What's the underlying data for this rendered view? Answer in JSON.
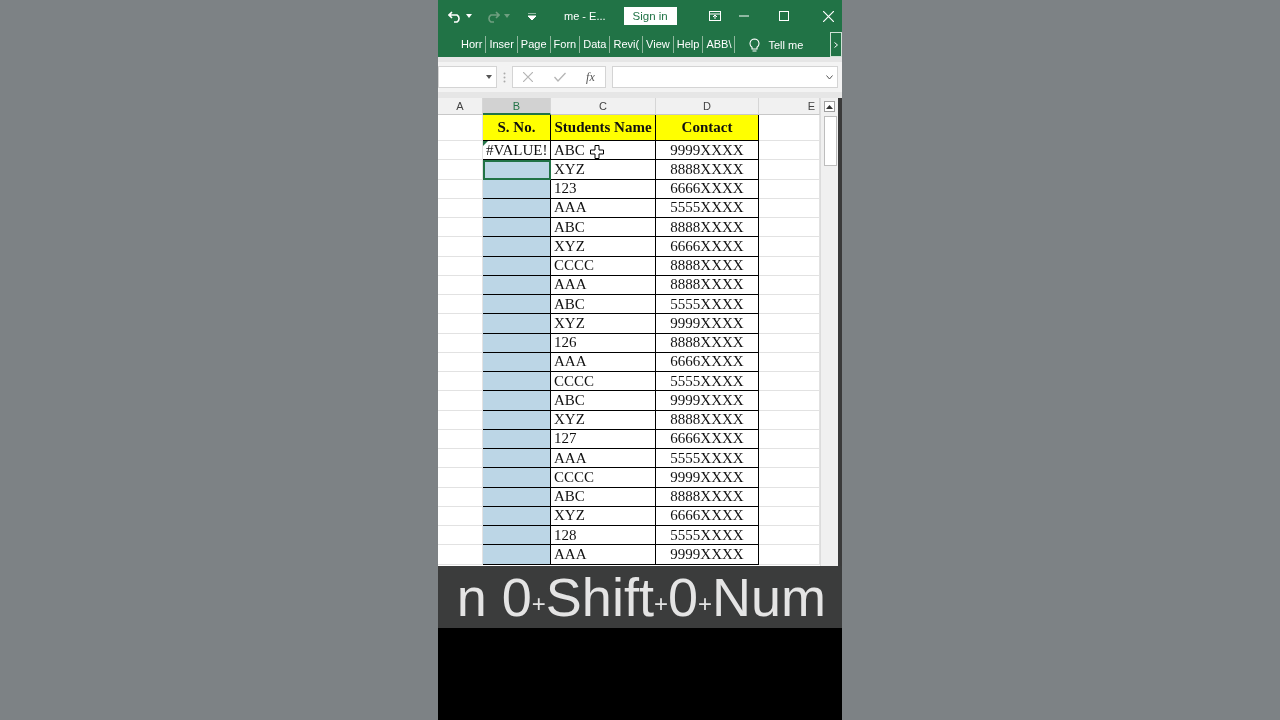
{
  "title_bar": {
    "file_name": "me  -  E...",
    "sign_in": "Sign in",
    "redo_disabled": true
  },
  "ribbon_tabs": [
    {
      "label": "Horr"
    },
    {
      "label": "Inser"
    },
    {
      "label": "Page"
    },
    {
      "label": "Forn"
    },
    {
      "label": "Data"
    },
    {
      "label": "Revi("
    },
    {
      "label": "View"
    },
    {
      "label": "Help"
    },
    {
      "label": "ABB\\"
    }
  ],
  "tell_me": "Tell me",
  "formula_bar": {
    "fx": "fx"
  },
  "columns": [
    {
      "label": "A",
      "selected": false
    },
    {
      "label": "B",
      "selected": true
    },
    {
      "label": "C",
      "selected": false
    },
    {
      "label": "D",
      "selected": false
    },
    {
      "label": "E",
      "selected": false
    }
  ],
  "header_row": [
    "S. No.",
    "Students Name",
    "Contact"
  ],
  "rows": [
    {
      "sno": "#VALUE!",
      "name": "ABC",
      "contact": "9999XXXX",
      "selected": false,
      "active": false,
      "error_flag": true
    },
    {
      "name": "XYZ",
      "contact": "8888XXXX",
      "selected": true,
      "active": true
    },
    {
      "name": "123",
      "contact": "6666XXXX",
      "selected": true,
      "active": false
    },
    {
      "name": "AAA",
      "contact": "5555XXXX",
      "selected": true,
      "active": false
    },
    {
      "name": "ABC",
      "contact": "8888XXXX",
      "selected": true,
      "active": false
    },
    {
      "name": "XYZ",
      "contact": "6666XXXX",
      "selected": true,
      "active": false
    },
    {
      "name": "CCCC",
      "contact": "8888XXXX",
      "selected": true,
      "active": false
    },
    {
      "name": "AAA",
      "contact": "8888XXXX",
      "selected": true,
      "active": false
    },
    {
      "name": "ABC",
      "contact": "5555XXXX",
      "selected": true,
      "active": false
    },
    {
      "name": "XYZ",
      "contact": "9999XXXX",
      "selected": true,
      "active": false
    },
    {
      "name": "126",
      "contact": "8888XXXX",
      "selected": true,
      "active": false
    },
    {
      "name": "AAA",
      "contact": "6666XXXX",
      "selected": true,
      "active": false
    },
    {
      "name": "CCCC",
      "contact": "5555XXXX",
      "selected": true,
      "active": false
    },
    {
      "name": "ABC",
      "contact": "9999XXXX",
      "selected": true,
      "active": false
    },
    {
      "name": "XYZ",
      "contact": "8888XXXX",
      "selected": true,
      "active": false
    },
    {
      "name": "127",
      "contact": "6666XXXX",
      "selected": true,
      "active": false
    },
    {
      "name": "AAA",
      "contact": "5555XXXX",
      "selected": true,
      "active": false
    },
    {
      "name": "CCCC",
      "contact": "9999XXXX",
      "selected": true,
      "active": false
    },
    {
      "name": "ABC",
      "contact": "8888XXXX",
      "selected": true,
      "active": false
    },
    {
      "name": "XYZ",
      "contact": "6666XXXX",
      "selected": true,
      "active": false
    },
    {
      "name": "128",
      "contact": "5555XXXX",
      "selected": true,
      "active": false
    },
    {
      "name": "AAA",
      "contact": "9999XXXX",
      "selected": true,
      "active": false
    }
  ],
  "caption": [
    {
      "kind": "key",
      "text": "n 0"
    },
    {
      "kind": "plus",
      "text": "+"
    },
    {
      "kind": "key",
      "text": "Shift"
    },
    {
      "kind": "plus",
      "text": "+"
    },
    {
      "kind": "key",
      "text": "0"
    },
    {
      "kind": "plus",
      "text": "+"
    },
    {
      "kind": "key",
      "text": "Num"
    }
  ]
}
